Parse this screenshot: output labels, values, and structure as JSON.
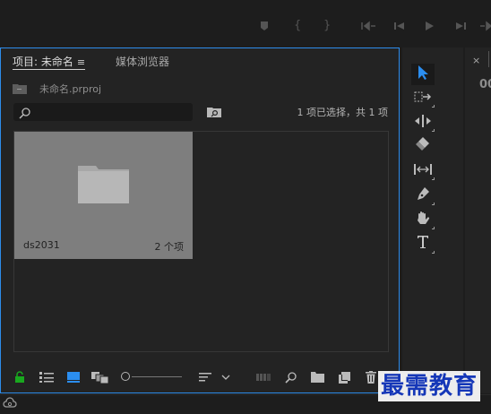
{
  "project_panel": {
    "tab_active": "项目: 未命名",
    "tab_menu_icon": "≡",
    "tab_inactive": "媒体浏览器",
    "project_file": "未命名.prproj",
    "search_value": "",
    "selection_status": "1 项已选择，共 1 项",
    "bin": {
      "name": "ds2031",
      "item_count": "2 个项"
    }
  },
  "right_panel": {
    "close": "×",
    "timecode_fragment": "00"
  },
  "watermark": "最需教育",
  "colors": {
    "panel_bg": "#232323",
    "app_bg": "#1d1d1d",
    "focus_border": "#2d8ceb",
    "selected_tool": "#2b8ef0",
    "lock_green": "#19a81f",
    "tile_bg": "#7e7e7e",
    "watermark_blue": "#1537b8"
  },
  "icons": {
    "transport": [
      "marker-icon",
      "mark-in-icon",
      "mark-out-icon",
      "go-to-in-icon",
      "step-back-icon",
      "play-icon",
      "step-forward-icon",
      "go-to-out-icon"
    ],
    "tools": [
      "selection-tool-icon",
      "track-select-tool-icon",
      "ripple-edit-tool-icon",
      "razor-tool-icon",
      "slip-tool-icon",
      "pen-tool-icon",
      "hand-tool-icon",
      "type-tool-icon"
    ],
    "bottom": [
      "lock-icon",
      "list-view-icon",
      "icon-view-icon",
      "freeform-view-icon",
      "zoom-slider",
      "sort-icon",
      "automate-to-sequence-icon",
      "find-icon",
      "new-bin-icon",
      "new-item-icon",
      "clear-icon"
    ]
  }
}
